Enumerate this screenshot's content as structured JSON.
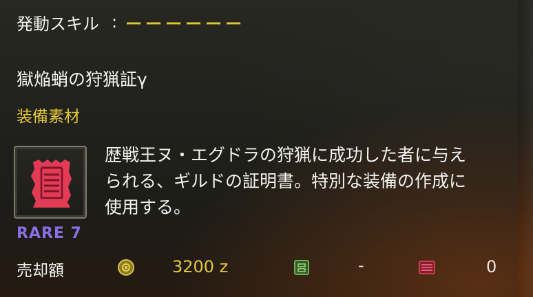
{
  "skill": {
    "label": "発動スキル",
    "separator": ":",
    "value": "ーーーーーー"
  },
  "item": {
    "name": "獄焔蛸の狩猟証γ",
    "category": "装備素材",
    "rarity": "RARE 7",
    "description": "歴戦王ヌ・エグドラの狩猟に成功した者に与えられる、ギルドの証明書。特別な装備の作成に使用する。",
    "icon": "red-certificate-scroll-icon"
  },
  "sell": {
    "label": "売却額",
    "zenny_icon": "zenny-coin-icon",
    "zenny": "3200 z",
    "points_icon": "guild-points-icon",
    "points": "-",
    "tickets_icon": "red-ticket-icon",
    "tickets": "0"
  },
  "colors": {
    "accent": "#e1c83a",
    "rarity": "#8a6fe4",
    "item_red": "#e33a55"
  }
}
